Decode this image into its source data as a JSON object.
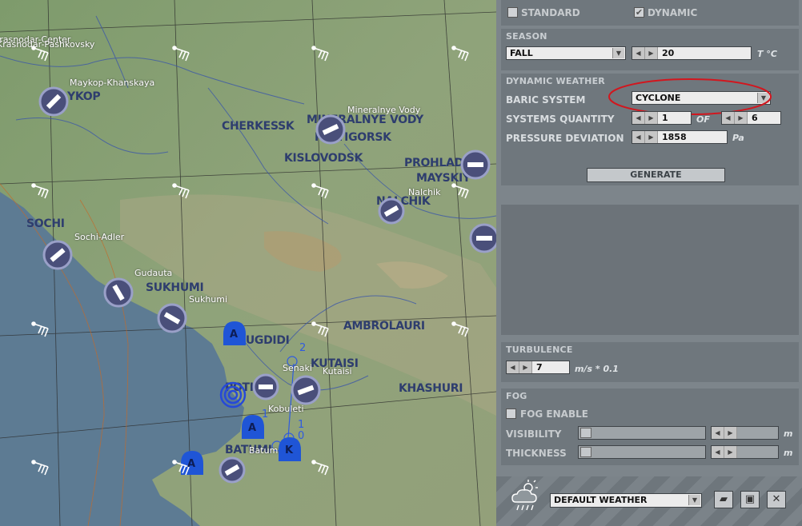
{
  "map": {
    "cities": [
      {
        "name": "YKOP"
      },
      {
        "name": "CHERKESSK"
      },
      {
        "name": "MINERALNYE VODY"
      },
      {
        "name": "PYATIGORSK"
      },
      {
        "name": "KISLOVODSK"
      },
      {
        "name": "PROHLADNY"
      },
      {
        "name": "MAYSKIY"
      },
      {
        "name": "NALCHIK"
      },
      {
        "name": "SOCHI"
      },
      {
        "name": "SUKHUMI"
      },
      {
        "name": "ZUGDIDI"
      },
      {
        "name": "AMBROLAURI"
      },
      {
        "name": "KUTAISI"
      },
      {
        "name": "KHASHURI"
      },
      {
        "name": "POTI"
      },
      {
        "name": "BATUMI"
      }
    ],
    "airfields": [
      {
        "name": "Krasnodar-Center"
      },
      {
        "name": "Krasnodar-Pashkovsky"
      },
      {
        "name": "Maykop-Khanskaya"
      },
      {
        "name": "Mineralnye Vody"
      },
      {
        "name": "Nalchik"
      },
      {
        "name": "Sochi-Adler"
      },
      {
        "name": "Gudauta"
      },
      {
        "name": "Sukhumi"
      },
      {
        "name": "Senaki"
      },
      {
        "name": "Kutaisi"
      },
      {
        "name": "Kobuleti"
      },
      {
        "name": "Batumi"
      }
    ],
    "weather_symbols": [
      {
        "letter": "A"
      },
      {
        "letter": "A"
      },
      {
        "letter": "A"
      },
      {
        "letter": "K"
      }
    ],
    "isobar_labels": [
      "2",
      "1",
      "1",
      "0"
    ]
  },
  "panel": {
    "mode": {
      "standard_label": "STANDARD",
      "standard_checked": false,
      "dynamic_label": "DYNAMIC",
      "dynamic_checked": true
    },
    "season": {
      "section": "SEASON",
      "value": "FALL",
      "temperature": "20",
      "temp_unit": "T °C"
    },
    "dynamic": {
      "section": "DYNAMIC WEATHER",
      "baric_label": "BARIC SYSTEM",
      "baric_value": "CYCLONE",
      "quantity_label": "SYSTEMS QUANTITY",
      "quantity_value": "1",
      "of_label": "OF",
      "quantity_total": "6",
      "pressure_label": "PRESSURE DEVIATION",
      "pressure_value": "1858",
      "pressure_unit": "Pa",
      "generate_label": "GENERATE"
    },
    "turbulence": {
      "section": "TURBULENCE",
      "value": "7",
      "unit": "m/s * 0.1"
    },
    "fog": {
      "section": "FOG",
      "enable_label": "FOG ENABLE",
      "enabled": false,
      "visibility_label": "VISIBILITY",
      "visibility_unit": "m",
      "thickness_label": "THICKNESS",
      "thickness_unit": "m"
    },
    "preset": {
      "value": "DEFAULT WEATHER"
    },
    "colors": {
      "highlight": "#d2161e",
      "panel": "#7d858b"
    }
  }
}
